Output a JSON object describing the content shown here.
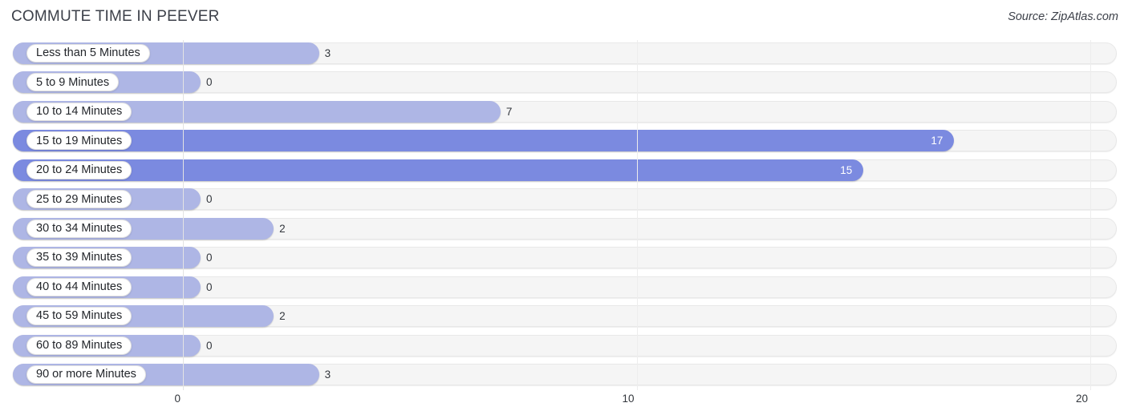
{
  "header": {
    "title": "COMMUTE TIME IN PEEVER",
    "source": "Source: ZipAtlas.com"
  },
  "colors": {
    "bar_light": "#aeb6e5",
    "bar_dark": "#7b8ae0",
    "track": "#f5f5f5",
    "track_border": "#e8e8e8",
    "gridline": "#e3e3e3",
    "text": "#33373d",
    "value_inside": "#ffffff"
  },
  "axis": {
    "ticks": [
      {
        "label": "0",
        "value": 0
      },
      {
        "label": "10",
        "value": 10
      },
      {
        "label": "20",
        "value": 20
      }
    ],
    "min": 0,
    "max": 20
  },
  "chart_data": {
    "type": "bar",
    "orientation": "horizontal",
    "title": "COMMUTE TIME IN PEEVER",
    "subtitle": "Source: ZipAtlas.com",
    "xlabel": "",
    "ylabel": "",
    "xlim": [
      0,
      20
    ],
    "grid": true,
    "legend": "none",
    "categories": [
      "Less than 5 Minutes",
      "5 to 9 Minutes",
      "10 to 14 Minutes",
      "15 to 19 Minutes",
      "20 to 24 Minutes",
      "25 to 29 Minutes",
      "30 to 34 Minutes",
      "35 to 39 Minutes",
      "40 to 44 Minutes",
      "45 to 59 Minutes",
      "60 to 89 Minutes",
      "90 or more Minutes"
    ],
    "values": [
      3,
      0,
      7,
      17,
      15,
      0,
      2,
      0,
      0,
      2,
      0,
      3
    ],
    "value_labels": [
      "3",
      "0",
      "7",
      "17",
      "15",
      "0",
      "2",
      "0",
      "0",
      "2",
      "0",
      "3"
    ]
  },
  "rows": [
    {
      "label": "Less than 5 Minutes",
      "value": 3,
      "value_label": "3",
      "shade": "light",
      "label_inside": false
    },
    {
      "label": "5 to 9 Minutes",
      "value": 0,
      "value_label": "0",
      "shade": "light",
      "label_inside": false
    },
    {
      "label": "10 to 14 Minutes",
      "value": 7,
      "value_label": "7",
      "shade": "light",
      "label_inside": false
    },
    {
      "label": "15 to 19 Minutes",
      "value": 17,
      "value_label": "17",
      "shade": "dark",
      "label_inside": true
    },
    {
      "label": "20 to 24 Minutes",
      "value": 15,
      "value_label": "15",
      "shade": "dark",
      "label_inside": true
    },
    {
      "label": "25 to 29 Minutes",
      "value": 0,
      "value_label": "0",
      "shade": "light",
      "label_inside": false
    },
    {
      "label": "30 to 34 Minutes",
      "value": 2,
      "value_label": "2",
      "shade": "light",
      "label_inside": false
    },
    {
      "label": "35 to 39 Minutes",
      "value": 0,
      "value_label": "0",
      "shade": "light",
      "label_inside": false
    },
    {
      "label": "40 to 44 Minutes",
      "value": 0,
      "value_label": "0",
      "shade": "light",
      "label_inside": false
    },
    {
      "label": "45 to 59 Minutes",
      "value": 2,
      "value_label": "2",
      "shade": "light",
      "label_inside": false
    },
    {
      "label": "60 to 89 Minutes",
      "value": 0,
      "value_label": "0",
      "shade": "light",
      "label_inside": false
    },
    {
      "label": "90 or more Minutes",
      "value": 3,
      "value_label": "3",
      "shade": "light",
      "label_inside": false
    }
  ]
}
